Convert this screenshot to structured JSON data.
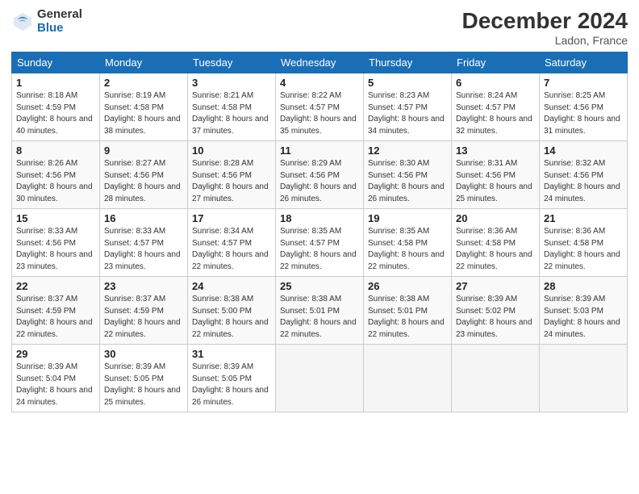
{
  "header": {
    "logo_general": "General",
    "logo_blue": "Blue",
    "month_year": "December 2024",
    "location": "Ladon, France"
  },
  "days_of_week": [
    "Sunday",
    "Monday",
    "Tuesday",
    "Wednesday",
    "Thursday",
    "Friday",
    "Saturday"
  ],
  "weeks": [
    [
      {
        "day": "1",
        "sunrise": "8:18 AM",
        "sunset": "4:59 PM",
        "daylight": "8 hours and 40 minutes."
      },
      {
        "day": "2",
        "sunrise": "8:19 AM",
        "sunset": "4:58 PM",
        "daylight": "8 hours and 38 minutes."
      },
      {
        "day": "3",
        "sunrise": "8:21 AM",
        "sunset": "4:58 PM",
        "daylight": "8 hours and 37 minutes."
      },
      {
        "day": "4",
        "sunrise": "8:22 AM",
        "sunset": "4:57 PM",
        "daylight": "8 hours and 35 minutes."
      },
      {
        "day": "5",
        "sunrise": "8:23 AM",
        "sunset": "4:57 PM",
        "daylight": "8 hours and 34 minutes."
      },
      {
        "day": "6",
        "sunrise": "8:24 AM",
        "sunset": "4:57 PM",
        "daylight": "8 hours and 32 minutes."
      },
      {
        "day": "7",
        "sunrise": "8:25 AM",
        "sunset": "4:56 PM",
        "daylight": "8 hours and 31 minutes."
      }
    ],
    [
      {
        "day": "8",
        "sunrise": "8:26 AM",
        "sunset": "4:56 PM",
        "daylight": "8 hours and 30 minutes."
      },
      {
        "day": "9",
        "sunrise": "8:27 AM",
        "sunset": "4:56 PM",
        "daylight": "8 hours and 28 minutes."
      },
      {
        "day": "10",
        "sunrise": "8:28 AM",
        "sunset": "4:56 PM",
        "daylight": "8 hours and 27 minutes."
      },
      {
        "day": "11",
        "sunrise": "8:29 AM",
        "sunset": "4:56 PM",
        "daylight": "8 hours and 26 minutes."
      },
      {
        "day": "12",
        "sunrise": "8:30 AM",
        "sunset": "4:56 PM",
        "daylight": "8 hours and 26 minutes."
      },
      {
        "day": "13",
        "sunrise": "8:31 AM",
        "sunset": "4:56 PM",
        "daylight": "8 hours and 25 minutes."
      },
      {
        "day": "14",
        "sunrise": "8:32 AM",
        "sunset": "4:56 PM",
        "daylight": "8 hours and 24 minutes."
      }
    ],
    [
      {
        "day": "15",
        "sunrise": "8:33 AM",
        "sunset": "4:56 PM",
        "daylight": "8 hours and 23 minutes."
      },
      {
        "day": "16",
        "sunrise": "8:33 AM",
        "sunset": "4:57 PM",
        "daylight": "8 hours and 23 minutes."
      },
      {
        "day": "17",
        "sunrise": "8:34 AM",
        "sunset": "4:57 PM",
        "daylight": "8 hours and 22 minutes."
      },
      {
        "day": "18",
        "sunrise": "8:35 AM",
        "sunset": "4:57 PM",
        "daylight": "8 hours and 22 minutes."
      },
      {
        "day": "19",
        "sunrise": "8:35 AM",
        "sunset": "4:58 PM",
        "daylight": "8 hours and 22 minutes."
      },
      {
        "day": "20",
        "sunrise": "8:36 AM",
        "sunset": "4:58 PM",
        "daylight": "8 hours and 22 minutes."
      },
      {
        "day": "21",
        "sunrise": "8:36 AM",
        "sunset": "4:58 PM",
        "daylight": "8 hours and 22 minutes."
      }
    ],
    [
      {
        "day": "22",
        "sunrise": "8:37 AM",
        "sunset": "4:59 PM",
        "daylight": "8 hours and 22 minutes."
      },
      {
        "day": "23",
        "sunrise": "8:37 AM",
        "sunset": "4:59 PM",
        "daylight": "8 hours and 22 minutes."
      },
      {
        "day": "24",
        "sunrise": "8:38 AM",
        "sunset": "5:00 PM",
        "daylight": "8 hours and 22 minutes."
      },
      {
        "day": "25",
        "sunrise": "8:38 AM",
        "sunset": "5:01 PM",
        "daylight": "8 hours and 22 minutes."
      },
      {
        "day": "26",
        "sunrise": "8:38 AM",
        "sunset": "5:01 PM",
        "daylight": "8 hours and 22 minutes."
      },
      {
        "day": "27",
        "sunrise": "8:39 AM",
        "sunset": "5:02 PM",
        "daylight": "8 hours and 23 minutes."
      },
      {
        "day": "28",
        "sunrise": "8:39 AM",
        "sunset": "5:03 PM",
        "daylight": "8 hours and 24 minutes."
      }
    ],
    [
      {
        "day": "29",
        "sunrise": "8:39 AM",
        "sunset": "5:04 PM",
        "daylight": "8 hours and 24 minutes."
      },
      {
        "day": "30",
        "sunrise": "8:39 AM",
        "sunset": "5:05 PM",
        "daylight": "8 hours and 25 minutes."
      },
      {
        "day": "31",
        "sunrise": "8:39 AM",
        "sunset": "5:05 PM",
        "daylight": "8 hours and 26 minutes."
      },
      null,
      null,
      null,
      null
    ]
  ]
}
